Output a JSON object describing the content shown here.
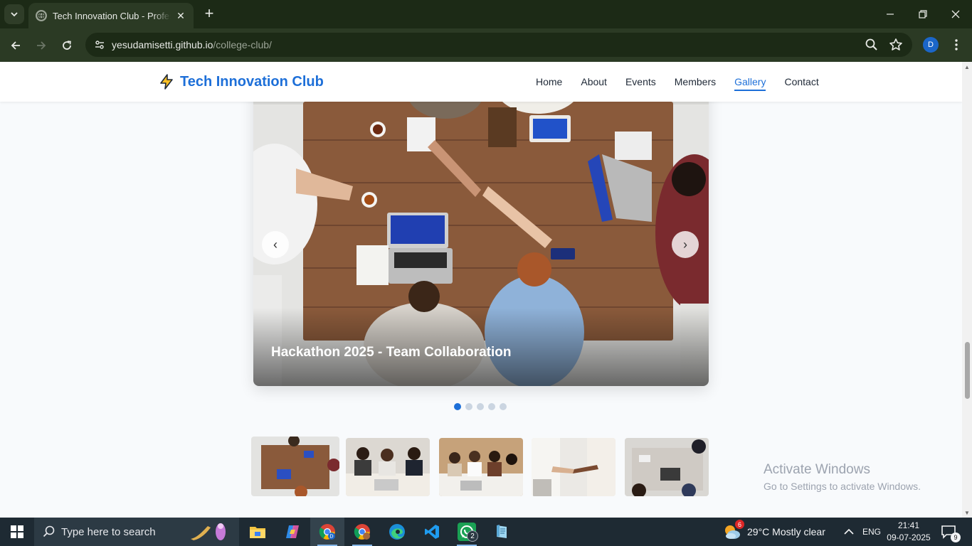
{
  "browser": {
    "tab_title": "Tech Innovation Club - Professional",
    "url_host": "yesudamisetti.github.io",
    "url_path": "/college-club/",
    "profile_initial": "D"
  },
  "site": {
    "logo_text": "Tech Innovation Club",
    "nav": [
      "Home",
      "About",
      "Events",
      "Members",
      "Gallery",
      "Contact"
    ],
    "active_nav": "Gallery"
  },
  "gallery": {
    "caption": "Hackathon 2025 - Team Collaboration",
    "prev_label": "‹",
    "next_label": "›",
    "slide_count": 5,
    "active_slide": 1,
    "thumbnail_count": 5
  },
  "watermark": {
    "line1": "Activate Windows",
    "line2": "Go to Settings to activate Windows."
  },
  "taskbar": {
    "search_placeholder": "Type here to search",
    "whatsapp_badge": "2",
    "weather_badge": "6",
    "weather_text": "29°C  Mostly clear",
    "language": "ENG",
    "time": "21:41",
    "date": "09-07-2025",
    "notification_count": "9"
  },
  "colors": {
    "accent": "#1d6fd8",
    "chrome_dark": "#1c2a16",
    "chrome_toolbar": "#2b3a24",
    "taskbar": "#1e2a33"
  }
}
